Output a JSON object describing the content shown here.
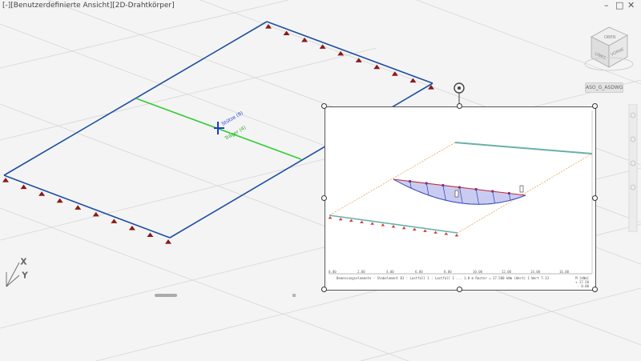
{
  "viewport": {
    "label": "[-][Benutzerdefinierte Ansicht][2D-Drahtkörper]",
    "window_controls": [
      "–",
      "□",
      "✕"
    ]
  },
  "viewcube": {
    "faces": [
      "OBEN",
      "LINKS",
      "VORNE"
    ],
    "view_name": "ASO_G_ASDWG"
  },
  "ucs_axes": {
    "x": "X",
    "y": "Y"
  },
  "model": {
    "line_labels": [
      "Stütze (9)",
      "Träger (4)"
    ],
    "colors": {
      "slab_edges": "#1f4fa3",
      "beam": "#33cc33",
      "supports": "#8b1a1a",
      "selection": "#1a3ccf"
    }
  },
  "embedded_view": {
    "status_text": "Bemessungselemente - Stabelement B1 : Lastfall 1 : Lastfall 1 ... 1.0 m Raster = 17.500 kNm (Wert) 1 Wert 7.13",
    "legend": [
      "M [kNm]",
      "+ 17.50",
      "- 0.00"
    ],
    "ruler_ticks": [
      "0.00",
      "2.00",
      "4.00",
      "6.00",
      "8.00",
      "10.00",
      "12.00",
      "14.00",
      "16.00"
    ],
    "colors": {
      "moment_curve": "#3344bb",
      "moment_fill": "#c9ccf0",
      "points": "#cc2233",
      "grid": "#e9a65a",
      "supports": "#d04040"
    }
  }
}
